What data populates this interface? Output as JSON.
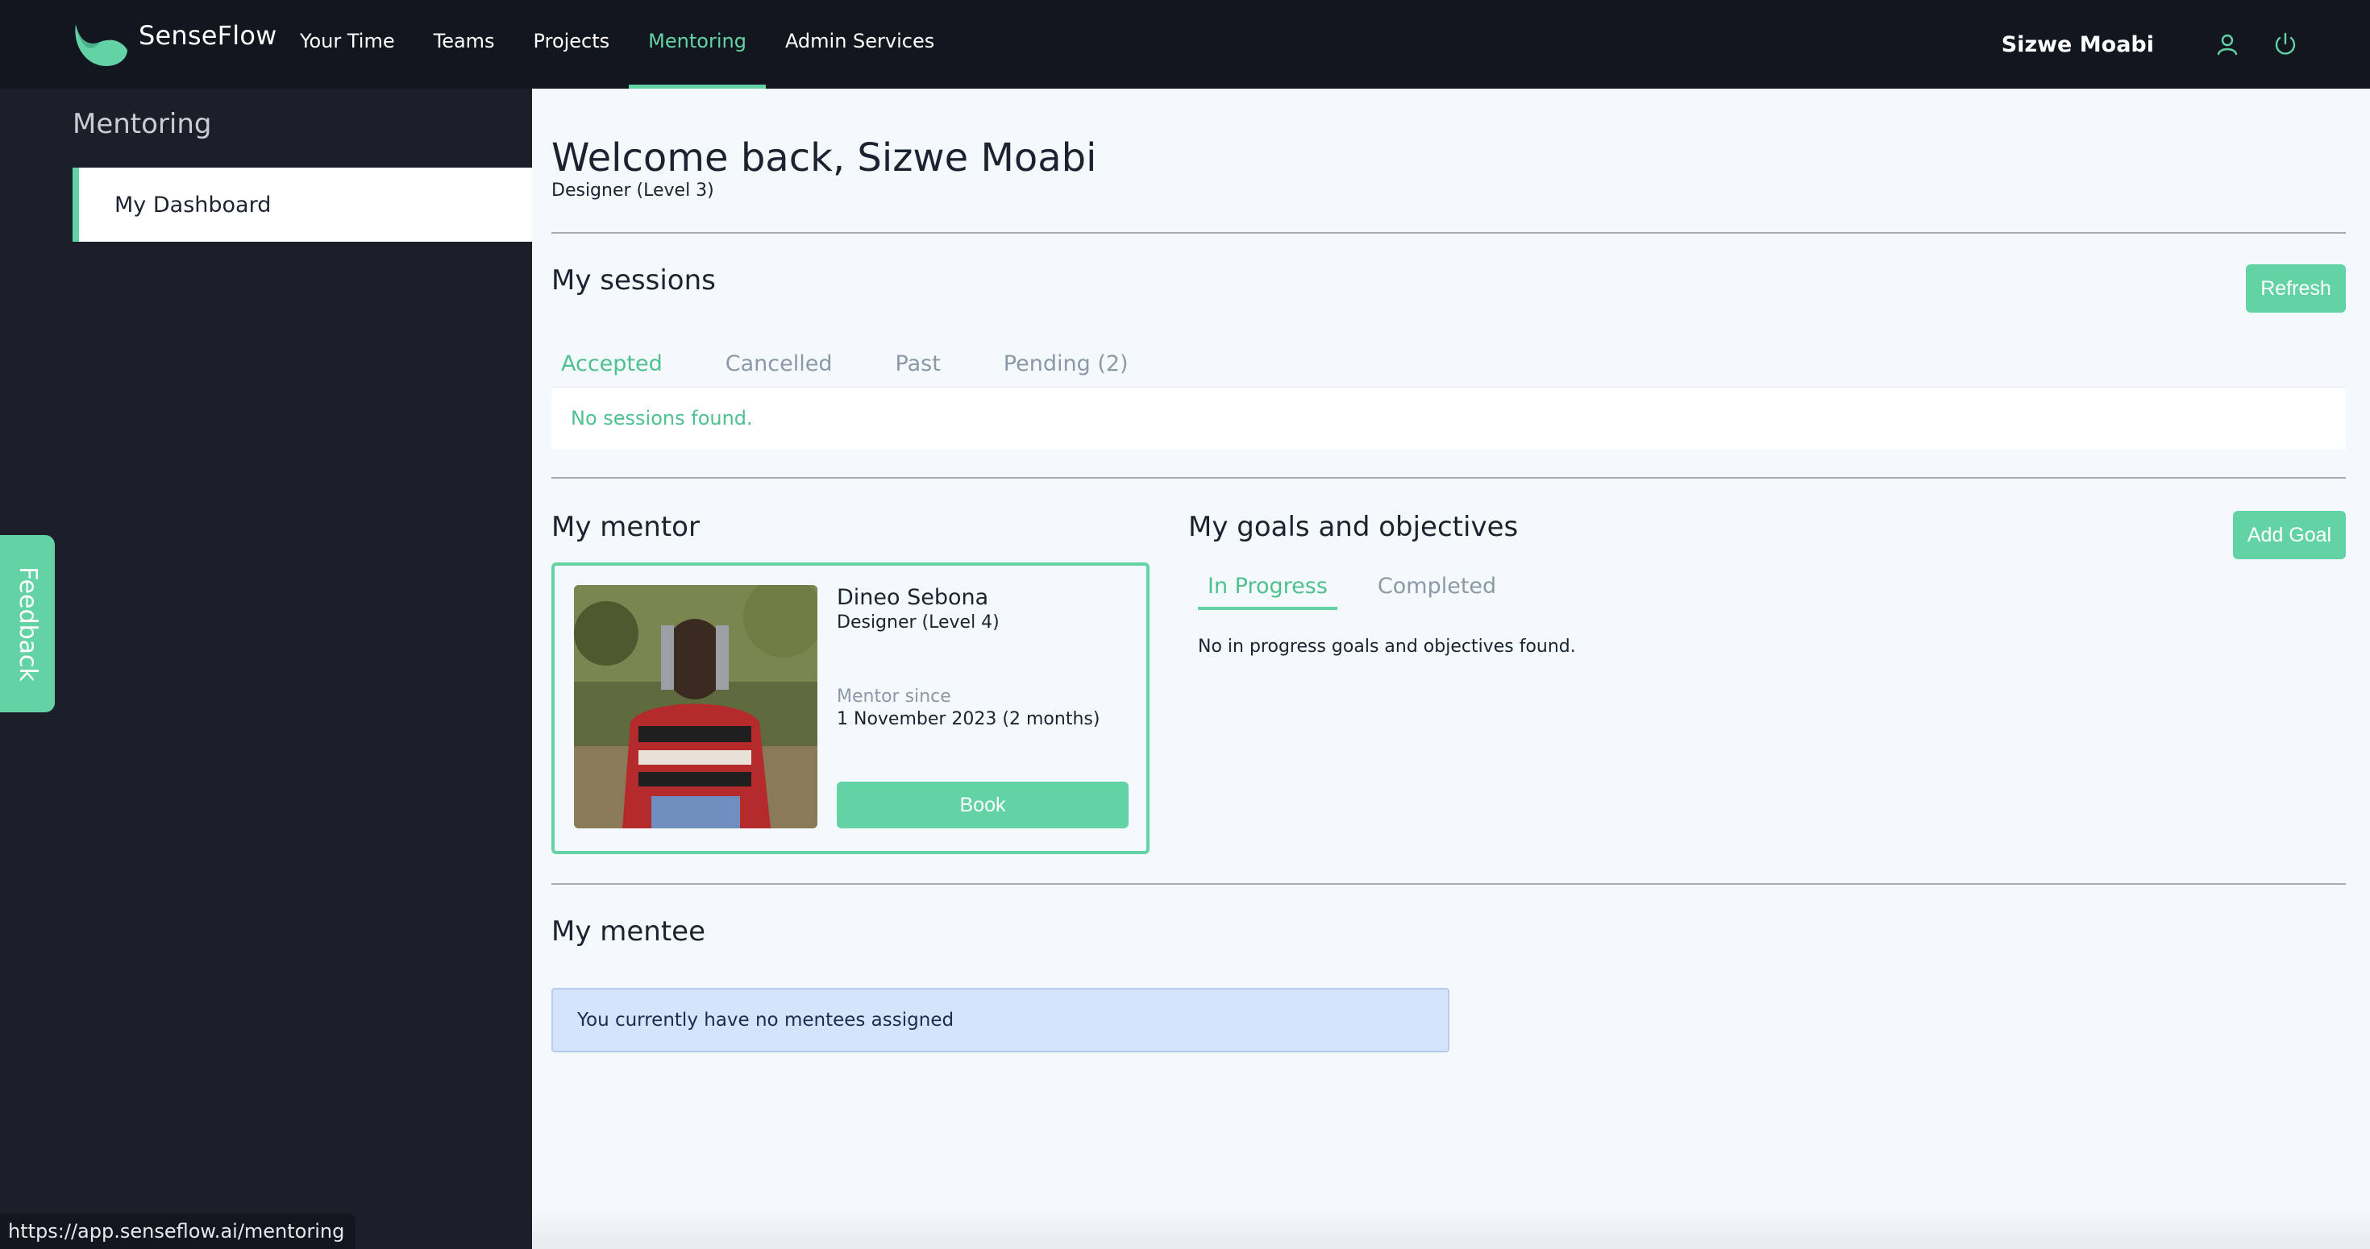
{
  "app": {
    "brand": "SenseFlow",
    "accent_color": "#63d3a6",
    "nav": [
      {
        "label": "Your Time"
      },
      {
        "label": "Teams"
      },
      {
        "label": "Projects"
      },
      {
        "label": "Mentoring",
        "active": true
      },
      {
        "label": "Admin Services"
      }
    ],
    "user": {
      "name": "Sizwe Moabi",
      "icons": [
        "user-icon",
        "power-icon"
      ]
    }
  },
  "sidebar": {
    "title": "Mentoring",
    "items": [
      {
        "label": "My Dashboard",
        "active": true
      }
    ],
    "feedback_label": "Feedback"
  },
  "status_bar": {
    "url": "https://app.senseflow.ai/mentoring"
  },
  "main": {
    "welcome": "Welcome back, Sizwe Moabi",
    "role": "Designer (Level 3)",
    "sessions": {
      "title": "My sessions",
      "refresh_label": "Refresh",
      "tabs": [
        {
          "label": "Accepted",
          "active": true
        },
        {
          "label": "Cancelled"
        },
        {
          "label": "Past"
        },
        {
          "label": "Pending (2)"
        }
      ],
      "empty_text": "No sessions found."
    },
    "mentor": {
      "title": "My mentor",
      "name": "Dineo Sebona",
      "role": "Designer (Level 4)",
      "since_label": "Mentor since",
      "since_value": "1 November 2023 (2 months)",
      "book_label": "Book"
    },
    "goals": {
      "title": "My goals and objectives",
      "add_label": "Add Goal",
      "tabs": [
        {
          "label": "In Progress",
          "active": true
        },
        {
          "label": "Completed"
        }
      ],
      "empty_text": "No in progress goals and objectives found."
    },
    "mentee": {
      "title": "My mentee",
      "empty_text": "You currently have no mentees assigned"
    }
  }
}
